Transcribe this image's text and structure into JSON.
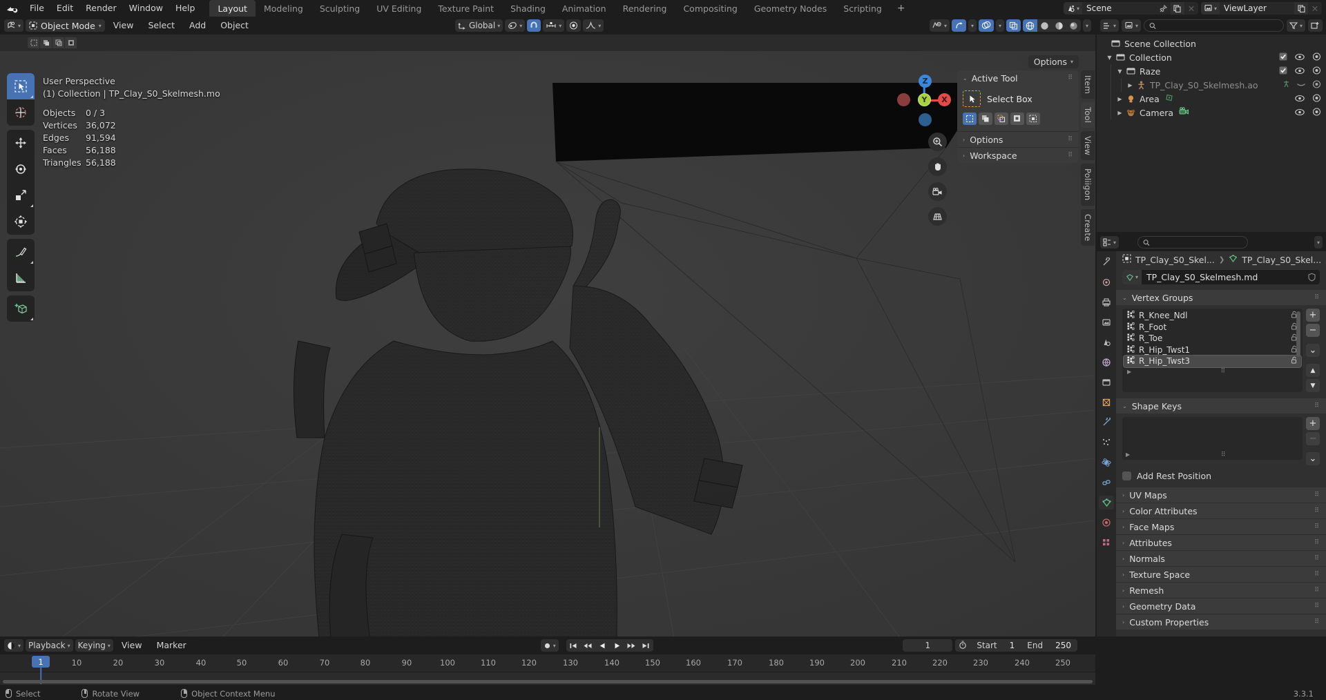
{
  "app": {
    "logo_icon": "blender-logo",
    "menus": [
      "File",
      "Edit",
      "Render",
      "Window",
      "Help"
    ],
    "workspace_tabs": [
      {
        "label": "Layout",
        "active": true
      },
      {
        "label": "Modeling",
        "active": false
      },
      {
        "label": "Sculpting",
        "active": false
      },
      {
        "label": "UV Editing",
        "active": false
      },
      {
        "label": "Texture Paint",
        "active": false
      },
      {
        "label": "Shading",
        "active": false
      },
      {
        "label": "Animation",
        "active": false
      },
      {
        "label": "Rendering",
        "active": false
      },
      {
        "label": "Compositing",
        "active": false
      },
      {
        "label": "Geometry Nodes",
        "active": false
      },
      {
        "label": "Scripting",
        "active": false
      }
    ],
    "add_workspace_label": "+",
    "scene": {
      "icon": "scene-icon",
      "name": "Scene",
      "pin_icon": "pin-icon",
      "dup_icon": "duplicate-icon",
      "close_icon": "x-icon"
    },
    "view_layer": {
      "icon": "viewlayer-icon",
      "name": "ViewLayer",
      "dup_icon": "duplicate-icon",
      "close_icon": "x-icon"
    }
  },
  "viewport": {
    "header": {
      "editor_type_icon": "editor-type-3dview-icon",
      "mode": "Object Mode",
      "menus": [
        "View",
        "Select",
        "Add",
        "Object"
      ],
      "transform_orientation": "Global",
      "orientation_icon": "orientation-icon",
      "snap_icon": "magnet-icon",
      "snap_target_icon": "snap-increment-icon",
      "proportional_icon": "proportional-edit-icon",
      "falloff_icon": "smooth-falloff-icon",
      "visibility_icon": "visibility-icon",
      "gizmo_icon": "gizmo-icon",
      "overlays_icon": "overlays-icon",
      "xray_icon": "xray-icon",
      "shading_modes": [
        "wireframe",
        "solid",
        "material-preview",
        "rendered"
      ],
      "active_shading": "wireframe"
    },
    "options_label": "Options",
    "stats": {
      "perspective": "User Perspective",
      "collection_line": "(1) Collection | TP_Clay_S0_Skelmesh.mo",
      "rows": [
        {
          "label": "Objects",
          "value": "0 / 3"
        },
        {
          "label": "Vertices",
          "value": "36,072"
        },
        {
          "label": "Edges",
          "value": "91,594"
        },
        {
          "label": "Faces",
          "value": "56,188"
        },
        {
          "label": "Triangles",
          "value": "56,188"
        }
      ]
    },
    "toolbar": [
      {
        "name": "select-box-tool",
        "icon": "cursor-box-icon",
        "active": true
      },
      {
        "name": "cursor-tool",
        "icon": "3d-cursor-icon",
        "active": false
      },
      {
        "name": "move-tool",
        "icon": "move-arrows-icon",
        "active": false
      },
      {
        "name": "rotate-tool",
        "icon": "rotate-icon",
        "active": false
      },
      {
        "name": "scale-tool",
        "icon": "scale-icon",
        "active": false
      },
      {
        "name": "transform-tool",
        "icon": "transform-icon",
        "active": false
      },
      {
        "name": "annotate-tool",
        "icon": "pencil-icon",
        "active": false
      },
      {
        "name": "measure-tool",
        "icon": "ruler-icon",
        "active": false
      },
      {
        "name": "add-cube-tool",
        "icon": "add-cube-icon",
        "active": false
      }
    ],
    "gizmo": {
      "axes": [
        "Z",
        "Y",
        "X"
      ],
      "colors": {
        "x": "#e04b4b",
        "y": "#a9d148",
        "z": "#3d87d6"
      }
    },
    "nav_buttons": [
      {
        "name": "zoom-button",
        "icon": "magnifier-plus-icon"
      },
      {
        "name": "pan-button",
        "icon": "hand-icon"
      },
      {
        "name": "camera-view-button",
        "icon": "camera-icon"
      },
      {
        "name": "toggle-perspective-button",
        "icon": "grid-perspective-icon"
      }
    ],
    "npanel": {
      "sections": [
        {
          "label": "Active Tool",
          "open": true
        },
        {
          "label": "Options",
          "open": false
        },
        {
          "label": "Workspace",
          "open": false
        }
      ],
      "active_tool_name": "Select Box",
      "active_tool_icon": "select-box-icon",
      "select_modes": [
        "set",
        "extend",
        "subtract",
        "invert",
        "intersect"
      ],
      "active_select_mode": "set"
    },
    "side_tabs": [
      "Item",
      "Tool",
      "View",
      "Poliigon",
      "Create"
    ],
    "active_side_tab": "Tool"
  },
  "outliner": {
    "display_mode_icon": "outliner-display-icon",
    "filter_icon": "filter-icon",
    "new_collection_icon": "new-collection-icon",
    "search": {
      "placeholder": "",
      "value": "",
      "icon": "search-icon"
    },
    "rows": [
      {
        "label": "Scene Collection",
        "icon": "collection-icon",
        "indent": 0,
        "tri": "",
        "checkbox": false,
        "eye": false,
        "camera": false,
        "dim": false
      },
      {
        "label": "Collection",
        "icon": "collection-icon",
        "indent": 1,
        "tri": "down",
        "checkbox": true,
        "eye": true,
        "camera": true,
        "dim": false
      },
      {
        "label": "Raze",
        "icon": "collection-icon",
        "indent": 2,
        "tri": "down",
        "checkbox": true,
        "eye": true,
        "camera": true,
        "dim": false
      },
      {
        "label": "TP_Clay_S0_Skelmesh.ao",
        "icon": "armature-icon",
        "indent": 3,
        "tri": "right",
        "checkbox": false,
        "eye": false,
        "camera": true,
        "dim": true,
        "badge": "armature-data-icon"
      },
      {
        "label": "Area",
        "icon": "light-icon",
        "indent": 2,
        "tri": "right",
        "checkbox": false,
        "eye": true,
        "camera": true,
        "dim": false,
        "badge": "light-data-icon"
      },
      {
        "label": "Camera",
        "icon": "camera-object-icon",
        "indent": 2,
        "tri": "right",
        "checkbox": false,
        "eye": true,
        "camera": true,
        "dim": false,
        "badge": "camera-data-icon"
      }
    ]
  },
  "properties": {
    "editor_icon": "properties-editor-icon",
    "search": {
      "placeholder": "",
      "value": "",
      "icon": "search-icon"
    },
    "dropdown_icon": "chevron-down-icon",
    "breadcrumb": [
      {
        "icon": "object-icon",
        "label": "TP_Clay_S0_Skel..."
      },
      {
        "icon": "mesh-data-icon",
        "label": "TP_Clay_S0_Skel..."
      }
    ],
    "pin_icon": "pin-icon",
    "name_field": {
      "icon": "mesh-data-icon",
      "value": "TP_Clay_S0_Skelmesh.md",
      "shield_icon": "shield-icon"
    },
    "tabs": [
      {
        "name": "tool",
        "icon": "tool-icon",
        "active": false
      },
      {
        "name": "render",
        "icon": "render-icon",
        "active": false
      },
      {
        "name": "output",
        "icon": "printer-icon",
        "active": false
      },
      {
        "name": "view-layer",
        "icon": "images-icon",
        "active": false
      },
      {
        "name": "scene",
        "icon": "scene-cone-icon",
        "active": false
      },
      {
        "name": "world",
        "icon": "world-icon",
        "active": false
      },
      {
        "name": "collection",
        "icon": "collection-props-icon",
        "active": false
      },
      {
        "name": "object",
        "icon": "object-props-icon",
        "active": false
      },
      {
        "name": "modifiers",
        "icon": "wrench-icon",
        "active": false
      },
      {
        "name": "particles",
        "icon": "particles-icon",
        "active": false
      },
      {
        "name": "physics",
        "icon": "physics-icon",
        "active": false
      },
      {
        "name": "constraints",
        "icon": "constraints-icon",
        "active": false
      },
      {
        "name": "object-data",
        "icon": "mesh-data-icon",
        "active": true
      },
      {
        "name": "material",
        "icon": "material-icon",
        "active": false
      },
      {
        "name": "texture",
        "icon": "texture-icon",
        "active": false
      }
    ],
    "vertex_groups": {
      "title": "Vertex Groups",
      "items": [
        {
          "name": "R_Knee_Ndl",
          "selected": false,
          "lock_icon": "unlock-icon"
        },
        {
          "name": "R_Foot",
          "selected": false,
          "lock_icon": "unlock-icon"
        },
        {
          "name": "R_Toe",
          "selected": false,
          "lock_icon": "unlock-icon"
        },
        {
          "name": "R_Hip_Twst1",
          "selected": false,
          "lock_icon": "unlock-icon"
        },
        {
          "name": "R_Hip_Twst3",
          "selected": true,
          "lock_icon": "unlock-icon"
        }
      ],
      "add_label": "+",
      "remove_label": "−",
      "menu_icon": "chevron-down-icon",
      "move_up_icon": "triangle-up-icon",
      "move_down_icon": "triangle-down-icon"
    },
    "shape_keys": {
      "title": "Shape Keys",
      "items": [],
      "add_label": "+",
      "remove_label": "−",
      "menu_icon": "chevron-down-icon",
      "add_rest_position_label": "Add Rest Position",
      "add_rest_position_checked": false
    },
    "collapsed_sections": [
      "UV Maps",
      "Color Attributes",
      "Face Maps",
      "Attributes",
      "Normals",
      "Texture Space",
      "Remesh",
      "Geometry Data",
      "Custom Properties"
    ]
  },
  "timeline": {
    "editor_icon": "timeline-editor-icon",
    "menus": [
      "Playback",
      "Keying",
      "View",
      "Marker"
    ],
    "record_icon": "record-icon",
    "transport": [
      {
        "name": "jump-start-button",
        "icon": "jump-to-start-icon"
      },
      {
        "name": "prev-keyframe-button",
        "icon": "prev-keyframe-icon"
      },
      {
        "name": "play-reverse-button",
        "icon": "play-reverse-icon"
      },
      {
        "name": "play-button",
        "icon": "play-icon"
      },
      {
        "name": "next-keyframe-button",
        "icon": "next-keyframe-icon"
      },
      {
        "name": "jump-end-button",
        "icon": "jump-to-end-icon"
      }
    ],
    "current_frame": "1",
    "auto_key_icon": "stopwatch-icon",
    "start_label": "Start",
    "start_value": "1",
    "end_label": "End",
    "end_value": "250",
    "ticks": [
      "10",
      "20",
      "30",
      "40",
      "50",
      "60",
      "70",
      "80",
      "90",
      "100",
      "110",
      "120",
      "130",
      "140",
      "150",
      "160",
      "170",
      "180",
      "190",
      "200",
      "210",
      "220",
      "230",
      "240",
      "250"
    ],
    "playhead_label": "1"
  },
  "statusbar": {
    "items": [
      {
        "icon": "mouse-left-icon",
        "label": "Select"
      },
      {
        "icon": "mouse-middle-icon",
        "label": "Rotate View"
      },
      {
        "icon": "mouse-right-icon",
        "label": "Object Context Menu"
      }
    ],
    "version": "3.3.1"
  },
  "colors": {
    "accent_blue": "#4772b3",
    "panel_bg": "#303030",
    "header_bg": "#1d1d1d",
    "viewport_bg": "#393939",
    "axis_x": "#e04b4b",
    "axis_y": "#a9d148",
    "axis_z": "#3d87d6"
  }
}
